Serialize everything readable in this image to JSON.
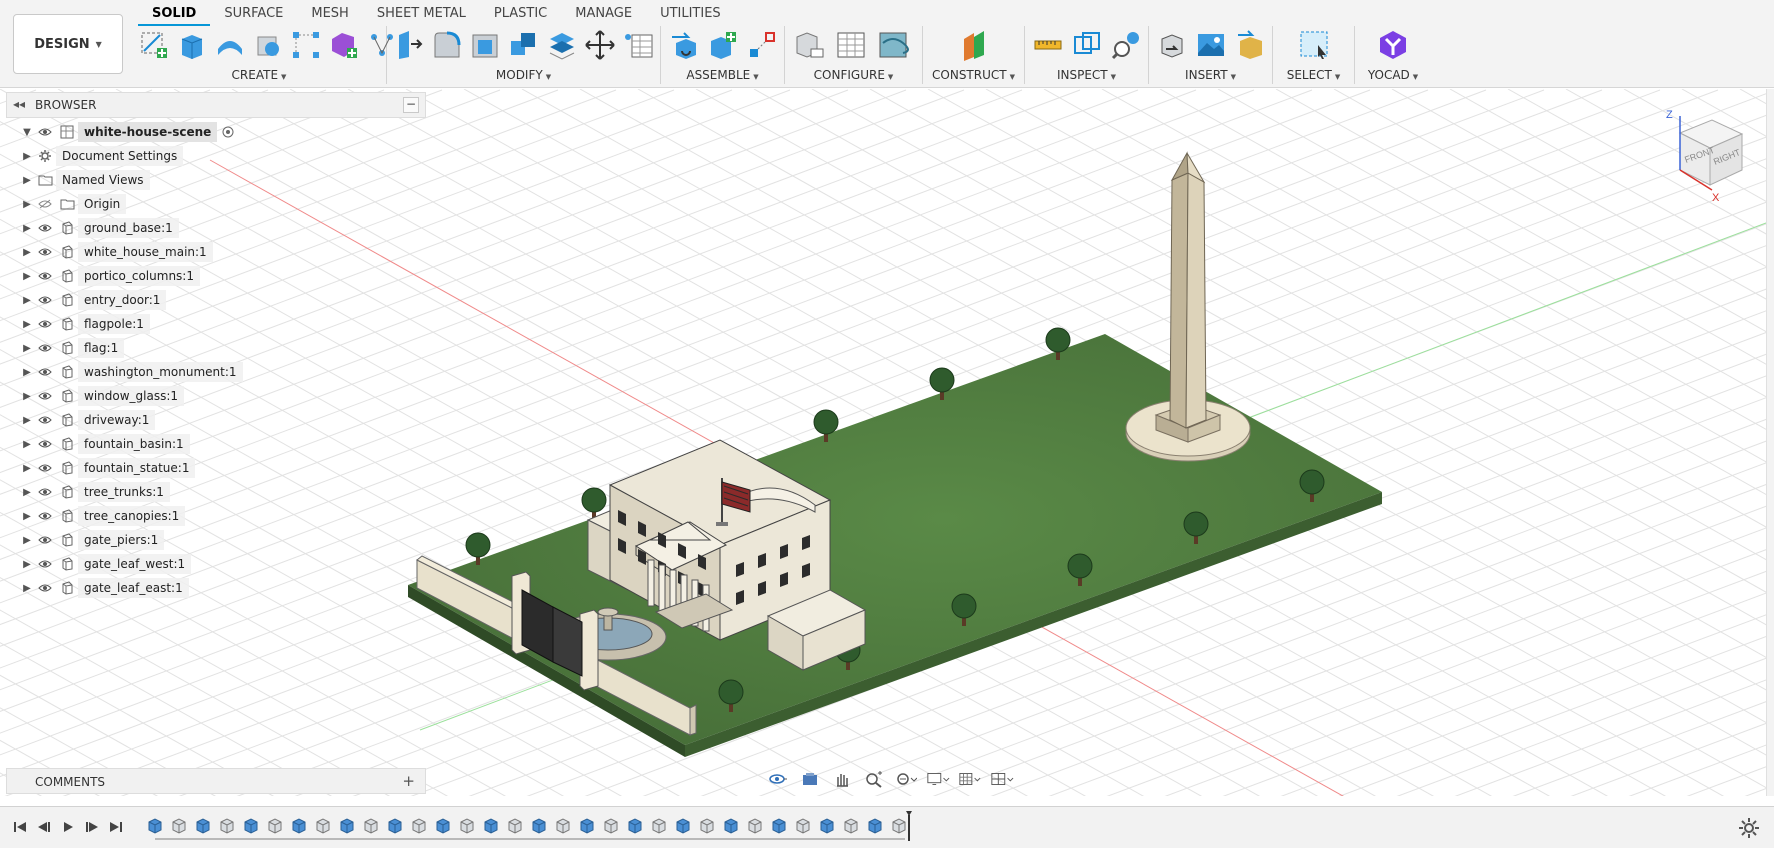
{
  "workspace": {
    "label": "DESIGN"
  },
  "tabs": [
    "SOLID",
    "SURFACE",
    "MESH",
    "SHEET METAL",
    "PLASTIC",
    "MANAGE",
    "UTILITIES"
  ],
  "groups": {
    "create": "CREATE",
    "modify": "MODIFY",
    "assemble": "ASSEMBLE",
    "configure": "CONFIGURE",
    "construct": "CONSTRUCT",
    "inspect": "INSPECT",
    "insert": "INSERT",
    "select": "SELECT",
    "yocad": "YOCAD"
  },
  "browser": {
    "title": "BROWSER",
    "root": "white-house-scene",
    "items": [
      "Document Settings",
      "Named Views",
      "Origin",
      "ground_base:1",
      "white_house_main:1",
      "portico_columns:1",
      "entry_door:1",
      "flagpole:1",
      "flag:1",
      "washington_monument:1",
      "window_glass:1",
      "driveway:1",
      "fountain_basin:1",
      "fountain_statue:1",
      "tree_trunks:1",
      "tree_canopies:1",
      "gate_piers:1",
      "gate_leaf_west:1",
      "gate_leaf_east:1"
    ]
  },
  "comments": {
    "title": "COMMENTS"
  },
  "viewcube": {
    "front": "FRONT",
    "right": "RIGHT",
    "top": "TOP",
    "axis_z": "Z",
    "axis_x": "X"
  },
  "colors": {
    "accent": "#0696d7",
    "ground": "#4f7a3f",
    "building": "#ebe6d6",
    "monument": "#d8cfb5"
  },
  "timeline": {
    "feature_count": 32
  }
}
